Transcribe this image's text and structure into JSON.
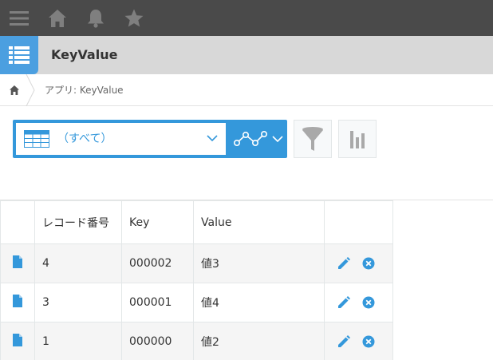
{
  "topbar": {
    "icons": [
      "menu-icon",
      "home-icon",
      "bell-icon",
      "star-icon"
    ]
  },
  "app": {
    "title": "KeyValue",
    "icon": "list-icon",
    "accent": "#4b9fe0"
  },
  "breadcrumb": {
    "text": "アプリ: KeyValue"
  },
  "toolbar": {
    "view_label": "（すべて）",
    "accent": "#3498db"
  },
  "table": {
    "columns": [
      "レコード番号",
      "Key",
      "Value"
    ],
    "rows": [
      {
        "no": "4",
        "key": "000002",
        "value": "値3"
      },
      {
        "no": "3",
        "key": "000001",
        "value": "値4"
      },
      {
        "no": "1",
        "key": "000000",
        "value": "値2"
      }
    ]
  }
}
